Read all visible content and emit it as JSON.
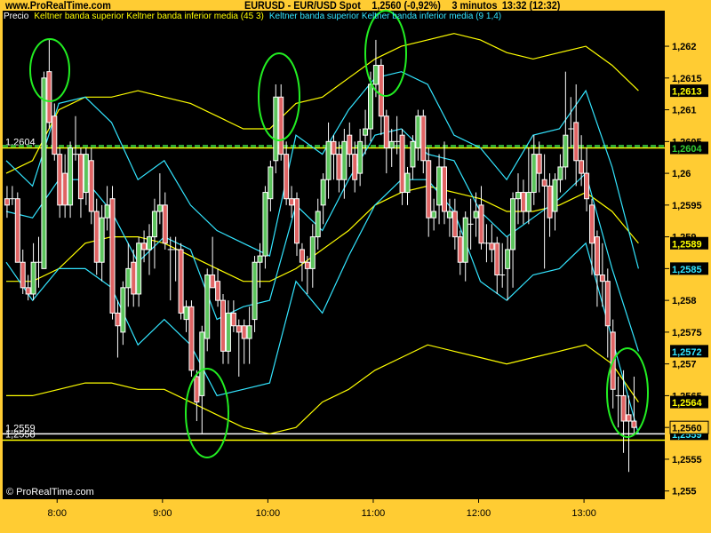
{
  "header": {
    "site": "www.ProRealTime.com",
    "instrument": "EURUSD - EUR/USD Spot",
    "price": "1,2560 (-0,92%)",
    "timeframe": "3 minutos",
    "time": "13:32 (12:32)"
  },
  "legend": {
    "price": "Precio",
    "keltner_45": "Keltner banda superior Keltner banda inferior media (45 3)",
    "keltner_9": "Keltner banda superior Keltner banda inferior media (9 1,4)"
  },
  "watermark": "© ProRealTime.com",
  "colors": {
    "background": "#FFCC33",
    "plot": "#000000",
    "up_candle": "#5CC45C",
    "down_candle": "#E06464",
    "candle_outline": "#FFFFFF",
    "keltner_45": "#FFFF00",
    "keltner_9": "#33E5FF",
    "annotation": "#22EE22"
  },
  "chart_data": {
    "type": "candlestick",
    "start_time": "07:30",
    "interval_minutes": 3,
    "x_range": [
      "07:29",
      "13:46"
    ],
    "ylim": [
      1.25487,
      1.26256
    ],
    "x_ticks": [
      {
        "time": "08:00",
        "label": "8:00"
      },
      {
        "time": "09:00",
        "label": "9:00"
      },
      {
        "time": "10:00",
        "label": "10:00"
      },
      {
        "time": "11:00",
        "label": "11:00"
      },
      {
        "time": "12:00",
        "label": "12:00"
      },
      {
        "time": "13:00",
        "label": "13:00"
      }
    ],
    "y_ticks": [
      {
        "value": 1.262,
        "label": "1,262"
      },
      {
        "value": 1.2615,
        "label": "1,2615"
      },
      {
        "value": 1.261,
        "label": "1,261"
      },
      {
        "value": 1.2605,
        "label": "1,2605"
      },
      {
        "value": 1.26,
        "label": "1,26"
      },
      {
        "value": 1.2595,
        "label": "1,2595"
      },
      {
        "value": 1.259,
        "label": "1,259"
      },
      {
        "value": 1.2585,
        "label": "1,2585"
      },
      {
        "value": 1.258,
        "label": "1,258"
      },
      {
        "value": 1.2575,
        "label": "1,2575"
      },
      {
        "value": 1.257,
        "label": "1,257"
      },
      {
        "value": 1.2565,
        "label": "1,2565"
      },
      {
        "value": 1.256,
        "label": "1,256"
      },
      {
        "value": 1.2555,
        "label": "1,2555"
      },
      {
        "value": 1.255,
        "label": "1,255"
      }
    ],
    "candles_ohlc": [
      [
        1.2596,
        1.2598,
        1.2593,
        1.2595
      ],
      [
        1.2596,
        1.2598,
        1.2595,
        1.2596
      ],
      [
        1.2596,
        1.2597,
        1.2586,
        1.2586
      ],
      [
        1.2586,
        1.2588,
        1.2581,
        1.2582
      ],
      [
        1.2582,
        1.2584,
        1.258,
        1.2581
      ],
      [
        1.2581,
        1.2589,
        1.258,
        1.2586
      ],
      [
        1.2586,
        1.259,
        1.2582,
        1.2586
      ],
      [
        1.2585,
        1.2616,
        1.2585,
        1.2615
      ],
      [
        1.2616,
        1.2621,
        1.2607,
        1.2608
      ],
      [
        1.2609,
        1.2611,
        1.2602,
        1.2603
      ],
      [
        1.2603,
        1.2604,
        1.2593,
        1.2595
      ],
      [
        1.26,
        1.2603,
        1.2593,
        1.2595
      ],
      [
        1.2595,
        1.2605,
        1.2593,
        1.2604
      ],
      [
        1.2603,
        1.2609,
        1.2602,
        1.2603
      ],
      [
        1.2603,
        1.2604,
        1.2593,
        1.2596
      ],
      [
        1.2597,
        1.2604,
        1.2595,
        1.2603
      ],
      [
        1.2602,
        1.2604,
        1.2592,
        1.2594
      ],
      [
        1.2594,
        1.2596,
        1.2584,
        1.2586
      ],
      [
        1.2586,
        1.2595,
        1.2583,
        1.2593
      ],
      [
        1.2593,
        1.2598,
        1.2591,
        1.2595
      ],
      [
        1.2596,
        1.2598,
        1.2577,
        1.2578
      ],
      [
        1.2578,
        1.258,
        1.2571,
        1.2576
      ],
      [
        1.2575,
        1.2583,
        1.2573,
        1.2582
      ],
      [
        1.2582,
        1.2589,
        1.2579,
        1.2585
      ],
      [
        1.2586,
        1.2588,
        1.2579,
        1.2581
      ],
      [
        1.2581,
        1.259,
        1.2579,
        1.2589
      ],
      [
        1.2589,
        1.2591,
        1.2586,
        1.2588
      ],
      [
        1.2588,
        1.2592,
        1.2584,
        1.259
      ],
      [
        1.259,
        1.2596,
        1.2585,
        1.2594
      ],
      [
        1.2594,
        1.26,
        1.2592,
        1.2595
      ],
      [
        1.2595,
        1.2597,
        1.2588,
        1.2589
      ],
      [
        1.2588,
        1.259,
        1.258,
        1.2588
      ],
      [
        1.2588,
        1.259,
        1.2583,
        1.2588
      ],
      [
        1.2588,
        1.2589,
        1.2577,
        1.2578
      ],
      [
        1.2577,
        1.258,
        1.2575,
        1.2579
      ],
      [
        1.2579,
        1.258,
        1.2568,
        1.2569
      ],
      [
        1.2568,
        1.2569,
        1.2561,
        1.2564
      ],
      [
        1.2565,
        1.2576,
        1.2559,
        1.2575
      ],
      [
        1.2574,
        1.2585,
        1.2572,
        1.2584
      ],
      [
        1.2584,
        1.259,
        1.2582,
        1.2582
      ],
      [
        1.2583,
        1.2585,
        1.2579,
        1.258
      ],
      [
        1.258,
        1.2581,
        1.257,
        1.2572
      ],
      [
        1.2572,
        1.258,
        1.257,
        1.2578
      ],
      [
        1.2578,
        1.258,
        1.2575,
        1.2576
      ],
      [
        1.2576,
        1.2577,
        1.2568,
        1.2575
      ],
      [
        1.2576,
        1.2577,
        1.257,
        1.2574
      ],
      [
        1.2574,
        1.2579,
        1.257,
        1.2576
      ],
      [
        1.2577,
        1.2587,
        1.2575,
        1.2586
      ],
      [
        1.2586,
        1.2589,
        1.2582,
        1.2587
      ],
      [
        1.2587,
        1.2598,
        1.2585,
        1.2597
      ],
      [
        1.2596,
        1.2602,
        1.2594,
        1.2601
      ],
      [
        1.2602,
        1.2614,
        1.26,
        1.2612
      ],
      [
        1.2612,
        1.2614,
        1.2602,
        1.2603
      ],
      [
        1.2603,
        1.2605,
        1.2595,
        1.2596
      ],
      [
        1.2596,
        1.2598,
        1.2593,
        1.2595
      ],
      [
        1.2596,
        1.2597,
        1.2587,
        1.2589
      ],
      [
        1.2588,
        1.2589,
        1.2583,
        1.2586
      ],
      [
        1.2586,
        1.2587,
        1.2581,
        1.2585
      ],
      [
        1.2585,
        1.2592,
        1.2582,
        1.259
      ],
      [
        1.259,
        1.2596,
        1.2588,
        1.2594
      ],
      [
        1.2595,
        1.26,
        1.2592,
        1.2599
      ],
      [
        1.2599,
        1.2608,
        1.2596,
        1.2605
      ],
      [
        1.2605,
        1.2606,
        1.2599,
        1.2603
      ],
      [
        1.2603,
        1.2605,
        1.2597,
        1.2599
      ],
      [
        1.2599,
        1.2607,
        1.2596,
        1.2605
      ],
      [
        1.2606,
        1.2608,
        1.2601,
        1.2603
      ],
      [
        1.2603,
        1.2605,
        1.2597,
        1.2599
      ],
      [
        1.26,
        1.2607,
        1.2598,
        1.2605
      ],
      [
        1.2606,
        1.261,
        1.2603,
        1.2607
      ],
      [
        1.2607,
        1.2616,
        1.2605,
        1.2614
      ],
      [
        1.2614,
        1.2621,
        1.2612,
        1.2617
      ],
      [
        1.2617,
        1.2618,
        1.2606,
        1.2609
      ],
      [
        1.2609,
        1.261,
        1.26,
        1.2604
      ],
      [
        1.2604,
        1.2607,
        1.2601,
        1.2605
      ],
      [
        1.2605,
        1.2609,
        1.2603,
        1.2605
      ],
      [
        1.2606,
        1.2607,
        1.2595,
        1.2597
      ],
      [
        1.2597,
        1.2601,
        1.2595,
        1.26
      ],
      [
        1.2601,
        1.2606,
        1.2599,
        1.2605
      ],
      [
        1.2604,
        1.261,
        1.2602,
        1.2609
      ],
      [
        1.2609,
        1.261,
        1.26,
        1.2602
      ],
      [
        1.2602,
        1.2604,
        1.259,
        1.2593
      ],
      [
        1.2593,
        1.2596,
        1.2591,
        1.2594
      ],
      [
        1.2595,
        1.2603,
        1.2592,
        1.2601
      ],
      [
        1.2601,
        1.2605,
        1.2592,
        1.2594
      ],
      [
        1.2593,
        1.2596,
        1.259,
        1.2594
      ],
      [
        1.2594,
        1.2596,
        1.2588,
        1.259
      ],
      [
        1.259,
        1.2591,
        1.2584,
        1.2586
      ],
      [
        1.2586,
        1.2594,
        1.2583,
        1.2593
      ],
      [
        1.2592,
        1.2596,
        1.2588,
        1.2592
      ],
      [
        1.2593,
        1.2597,
        1.259,
        1.2594
      ],
      [
        1.2595,
        1.2598,
        1.2588,
        1.2589
      ],
      [
        1.2589,
        1.2592,
        1.2586,
        1.2589
      ],
      [
        1.2589,
        1.2592,
        1.2586,
        1.2588
      ],
      [
        1.2589,
        1.259,
        1.2581,
        1.2584
      ],
      [
        1.2584,
        1.2589,
        1.2582,
        1.2584
      ],
      [
        1.2585,
        1.259,
        1.258,
        1.2588
      ],
      [
        1.2588,
        1.2597,
        1.2582,
        1.2596
      ],
      [
        1.2596,
        1.26,
        1.2592,
        1.2597
      ],
      [
        1.2597,
        1.2599,
        1.2592,
        1.2594
      ],
      [
        1.2594,
        1.2604,
        1.2592,
        1.2597
      ],
      [
        1.2597,
        1.2606,
        1.2595,
        1.2603
      ],
      [
        1.2603,
        1.2605,
        1.2597,
        1.26
      ],
      [
        1.2599,
        1.2603,
        1.2585,
        1.2598
      ],
      [
        1.2598,
        1.26,
        1.259,
        1.2593
      ],
      [
        1.2594,
        1.26,
        1.2591,
        1.2599
      ],
      [
        1.2599,
        1.2603,
        1.2597,
        1.2601
      ],
      [
        1.2601,
        1.2616,
        1.2599,
        1.2606
      ],
      [
        1.2607,
        1.2612,
        1.2604,
        1.2607
      ],
      [
        1.2608,
        1.2614,
        1.2598,
        1.2602
      ],
      [
        1.2602,
        1.2606,
        1.2598,
        1.26
      ],
      [
        1.26,
        1.2604,
        1.2594,
        1.2596
      ],
      [
        1.2595,
        1.2596,
        1.2584,
        1.2589
      ],
      [
        1.259,
        1.2591,
        1.2579,
        1.2584
      ],
      [
        1.2584,
        1.2589,
        1.2579,
        1.2583
      ],
      [
        1.2583,
        1.2585,
        1.2571,
        1.2576
      ],
      [
        1.2575,
        1.2577,
        1.2563,
        1.2566
      ],
      [
        1.2565,
        1.2568,
        1.256,
        1.2565
      ],
      [
        1.2565,
        1.2569,
        1.2556,
        1.2561
      ],
      [
        1.2562,
        1.2565,
        1.2553,
        1.2561
      ],
      [
        1.2561,
        1.2568,
        1.2559,
        1.256
      ]
    ],
    "band_times": [
      "07:31",
      "07:46",
      "08:01",
      "08:16",
      "08:31",
      "08:46",
      "09:01",
      "09:16",
      "09:31",
      "09:46",
      "10:01",
      "10:16",
      "10:31",
      "10:46",
      "11:01",
      "11:16",
      "11:31",
      "11:46",
      "12:01",
      "12:16",
      "12:31",
      "12:46",
      "13:01",
      "13:16",
      "13:31"
    ],
    "series": [
      {
        "name": "Keltner banda superior (45 3)",
        "band": "keltner_45",
        "values": [
          1.26,
          1.2602,
          1.261,
          1.2612,
          1.2612,
          1.2613,
          1.2612,
          1.2611,
          1.2609,
          1.2607,
          1.2607,
          1.2611,
          1.2612,
          1.2615,
          1.2618,
          1.262,
          1.2621,
          1.2622,
          1.2621,
          1.2619,
          1.2618,
          1.2619,
          1.262,
          1.2617,
          1.2613
        ]
      },
      {
        "name": "media (45 3)",
        "band": "keltner_45",
        "values": [
          1.2583,
          1.2583,
          1.2585,
          1.2589,
          1.259,
          1.259,
          1.2589,
          1.2587,
          1.2585,
          1.2583,
          1.2583,
          1.2585,
          1.2588,
          1.2591,
          1.2595,
          1.2597,
          1.2598,
          1.2597,
          1.2596,
          1.2594,
          1.2594,
          1.2595,
          1.2597,
          1.2594,
          1.2589
        ]
      },
      {
        "name": "Keltner banda inferior (45 3)",
        "band": "keltner_45",
        "values": [
          1.2565,
          1.2565,
          1.2566,
          1.2567,
          1.2567,
          1.2566,
          1.2566,
          1.2564,
          1.2562,
          1.256,
          1.2559,
          1.256,
          1.2564,
          1.2566,
          1.2569,
          1.2571,
          1.2573,
          1.2572,
          1.2571,
          1.257,
          1.2571,
          1.2572,
          1.2573,
          1.257,
          1.2564
        ]
      },
      {
        "name": "Keltner banda superior (9 1,4)",
        "band": "keltner_9",
        "values": [
          1.2602,
          1.2598,
          1.2611,
          1.2612,
          1.2608,
          1.2599,
          1.2602,
          1.2595,
          1.2591,
          1.2589,
          1.2587,
          1.2606,
          1.2603,
          1.261,
          1.2615,
          1.2616,
          1.2614,
          1.2606,
          1.2604,
          1.2599,
          1.2606,
          1.2607,
          1.2613,
          1.2601,
          1.2585
        ]
      },
      {
        "name": "media (9 1,4)",
        "band": "keltner_9",
        "values": [
          1.2594,
          1.2593,
          1.2599,
          1.2599,
          1.2594,
          1.2586,
          1.259,
          1.2588,
          1.2577,
          1.2579,
          1.258,
          1.2595,
          1.2591,
          1.2599,
          1.2606,
          1.2607,
          1.2603,
          1.2602,
          1.2594,
          1.259,
          1.2593,
          1.2596,
          1.26,
          1.2585,
          1.2572
        ]
      },
      {
        "name": "Keltner banda inferior (9 1,4)",
        "band": "keltner_9",
        "values": [
          1.2586,
          1.258,
          1.2585,
          1.2585,
          1.2582,
          1.2573,
          1.2577,
          1.2573,
          1.2565,
          1.2566,
          1.2567,
          1.2583,
          1.2578,
          1.2587,
          1.2595,
          1.2599,
          1.2599,
          1.2594,
          1.2583,
          1.258,
          1.2584,
          1.2585,
          1.2589,
          1.2574,
          1.2559
        ]
      }
    ],
    "horizontal_lines": [
      {
        "price": 1.2604,
        "label": "1,2604",
        "color": "#FFFF00",
        "style": "solid"
      },
      {
        "price": 1.2604,
        "label": "",
        "color": "#33AA33",
        "style": "dashed"
      },
      {
        "price": 1.2559,
        "label": "1,2559",
        "color": "#FFFFFF",
        "style": "solid"
      },
      {
        "price": 1.2558,
        "label": "1,2558",
        "color": "#FFFF00",
        "style": "solid"
      }
    ],
    "price_labels": [
      {
        "value": 1.2613,
        "text": "1,2613",
        "color": "#FFFF00",
        "bg": "#000000"
      },
      {
        "value": 1.2604,
        "text": "1,2604",
        "color": "#33CC33",
        "bg": "#000000"
      },
      {
        "value": 1.2589,
        "text": "1,2589",
        "color": "#FFFF00",
        "bg": "#000000"
      },
      {
        "value": 1.2585,
        "text": "1,2585",
        "color": "#33E5FF",
        "bg": "#000000"
      },
      {
        "value": 1.2572,
        "text": "1,2572",
        "color": "#33E5FF",
        "bg": "#000000"
      },
      {
        "value": 1.2564,
        "text": "1,2564",
        "color": "#FFFF00",
        "bg": "#000000"
      },
      {
        "value": 1.2559,
        "text": "1,2559",
        "color": "#33E5FF",
        "bg": "#000000"
      },
      {
        "value": 1.256,
        "text": "1,2560",
        "color": "#000000",
        "bg": "#FFCC33"
      }
    ]
  }
}
